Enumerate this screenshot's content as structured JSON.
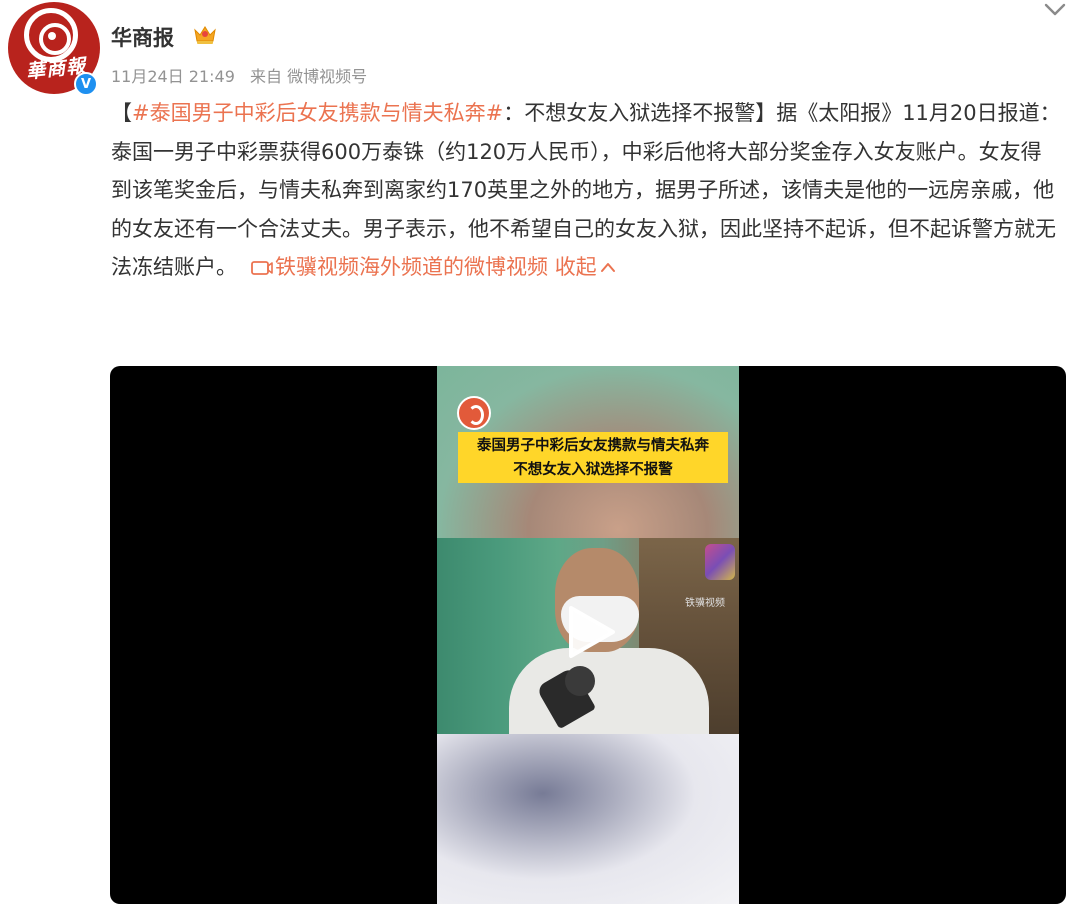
{
  "account": {
    "name": "华商报",
    "avatar_text": "華商報",
    "avatar_icon": "newspaper-logo-icon",
    "verified_icon": "verified-badge-icon",
    "verified_glyph": "V",
    "crown_icon": "crown-icon"
  },
  "meta": {
    "time": "11月24日 21:49",
    "source": "来自 微博视频号"
  },
  "post": {
    "bracket_open": "【",
    "hashtag": "#泰国男子中彩后女友携款与情夫私奔#",
    "body": "：不想女友入狱选择不报警】据《太阳报》11月20日报道：泰国一男子中彩票获得600万泰铢（约120万人民币），中彩后他将大部分奖金存入女友账户。女友得到该笔奖金后，与情夫私奔到离家约170英里之外的地方，据男子所述，该情夫是他的一远房亲戚，他的女友还有一个合法丈夫。男子表示，他不希望自己的女友入狱，因此坚持不起诉，但不起诉警方就无法冻结账户。",
    "video_link": "铁骥视频海外频道的微博视频",
    "collapse": "收起"
  },
  "video": {
    "caption_line1": "泰国男子中彩后女友携款与情夫私奔",
    "caption_line2": "不想女友入狱选择不报警",
    "channel_watermark": "铁骥视频",
    "play_icon": "play-icon"
  },
  "colors": {
    "accent": "#eb7350",
    "text": "#333333",
    "meta": "#939393",
    "verified": "#1e90f0",
    "caption_bg": "#ffd629"
  }
}
